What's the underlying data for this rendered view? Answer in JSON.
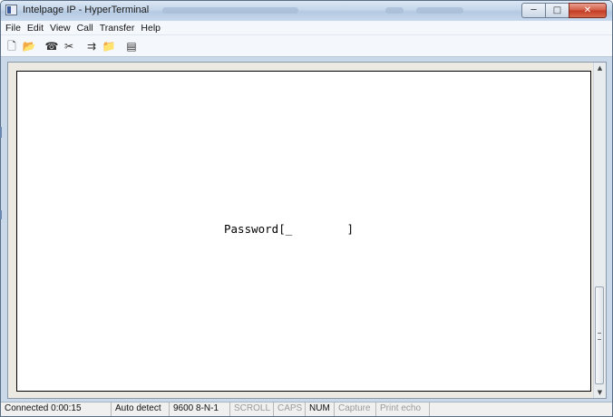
{
  "window": {
    "title": "Intelpage IP - HyperTerminal",
    "controls": {
      "minimize": "─",
      "maximize": "□",
      "close": "✕"
    }
  },
  "menu": [
    "File",
    "Edit",
    "View",
    "Call",
    "Transfer",
    "Help"
  ],
  "toolbar": {
    "icons": [
      "new-connection-icon",
      "open-icon",
      "connect-icon",
      "disconnect-icon",
      "send-icon",
      "receive-icon",
      "properties-icon"
    ],
    "glyphs": [
      "🗋",
      "📂",
      "☎",
      "✂",
      "⇉",
      "📁",
      "▤"
    ]
  },
  "terminal": {
    "prompt": "Password[_        ]"
  },
  "status": {
    "connected": "Connected 0:00:15",
    "detect": "Auto detect",
    "settings": "9600 8-N-1",
    "scroll": "SCROLL",
    "caps": "CAPS",
    "num": "NUM",
    "capture": "Capture",
    "print_echo": "Print echo"
  },
  "colors": {
    "titlebar": "#c3d5e9",
    "close_button": "#c13a22",
    "terminal_bg": "#ffffff"
  }
}
